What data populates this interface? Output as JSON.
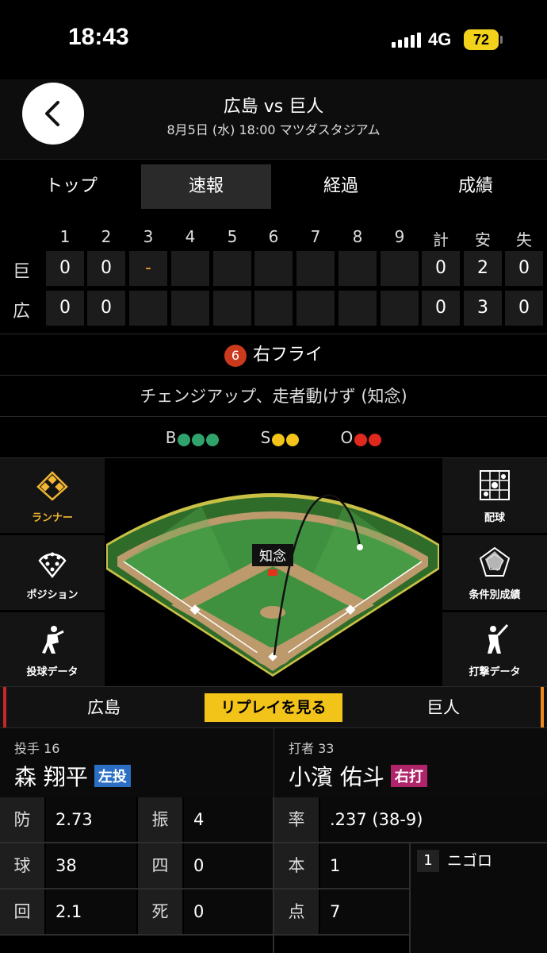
{
  "status_bar": {
    "time": "18:43",
    "network": "4G",
    "battery": "72"
  },
  "header": {
    "title": "広島 vs 巨人",
    "subtitle": "8月5日 (水) 18:00 マツダスタジアム"
  },
  "tabs": [
    {
      "label": "トップ",
      "active": false
    },
    {
      "label": "速報",
      "active": true
    },
    {
      "label": "経過",
      "active": false
    },
    {
      "label": "成績",
      "active": false
    }
  ],
  "scoreboard": {
    "headers": [
      "1",
      "2",
      "3",
      "4",
      "5",
      "6",
      "7",
      "8",
      "9",
      "計",
      "安",
      "失"
    ],
    "rows": [
      {
        "team": "巨",
        "innings": [
          "0",
          "0",
          "-",
          "",
          "",
          "",
          "",
          "",
          ""
        ],
        "totals": [
          "0",
          "2",
          "0"
        ]
      },
      {
        "team": "広",
        "innings": [
          "0",
          "0",
          "",
          "",
          "",
          "",
          "",
          "",
          ""
        ],
        "totals": [
          "0",
          "3",
          "0"
        ]
      }
    ]
  },
  "play": {
    "number": "6",
    "result": "右フライ",
    "description": "チェンジアップ、走者動けず (知念)"
  },
  "count": {
    "b_label": "B",
    "s_label": "S",
    "o_label": "O",
    "balls": 3,
    "strikes": 2,
    "outs": 2,
    "colors": {
      "ball": "#2fa36b",
      "strike": "#f2c318",
      "out": "#e0281e"
    }
  },
  "field": {
    "left_buttons": [
      {
        "label": "ランナー",
        "icon": "diamond-runner-icon",
        "active": true
      },
      {
        "label": "ポジション",
        "icon": "position-dots-icon",
        "active": false
      },
      {
        "label": "投球データ",
        "icon": "pitcher-icon",
        "active": false
      }
    ],
    "right_buttons": [
      {
        "label": "配球",
        "icon": "pitch-grid-icon"
      },
      {
        "label": "条件別成績",
        "icon": "radar-chart-icon"
      },
      {
        "label": "打撃データ",
        "icon": "batter-icon"
      }
    ],
    "fielder_label": "知念"
  },
  "teambar": {
    "home": "広島",
    "away": "巨人",
    "replay": "リプレイを見る"
  },
  "pitcher": {
    "role": "投手 16",
    "name": "森 翔平",
    "hand": "左投",
    "hand_color": "#2a6fc4"
  },
  "batter": {
    "role": "打者 33",
    "name": "小濱 佑斗",
    "hand": "右打",
    "hand_color": "#b0246a"
  },
  "pitcher_stats": [
    {
      "k1": "防",
      "v1": "2.73",
      "k2": "振",
      "v2": "4"
    },
    {
      "k1": "球",
      "v1": "38",
      "k2": "四",
      "v2": "0"
    },
    {
      "k1": "回",
      "v1": "2.1",
      "k2": "死",
      "v2": "0"
    }
  ],
  "batter_stats": [
    {
      "k": "率",
      "v": ".237 (38-9)"
    },
    {
      "k": "本",
      "v": "1"
    },
    {
      "k": "点",
      "v": "7"
    }
  ],
  "at_bat_history": [
    {
      "no": "1",
      "result": "ニゴロ"
    }
  ]
}
